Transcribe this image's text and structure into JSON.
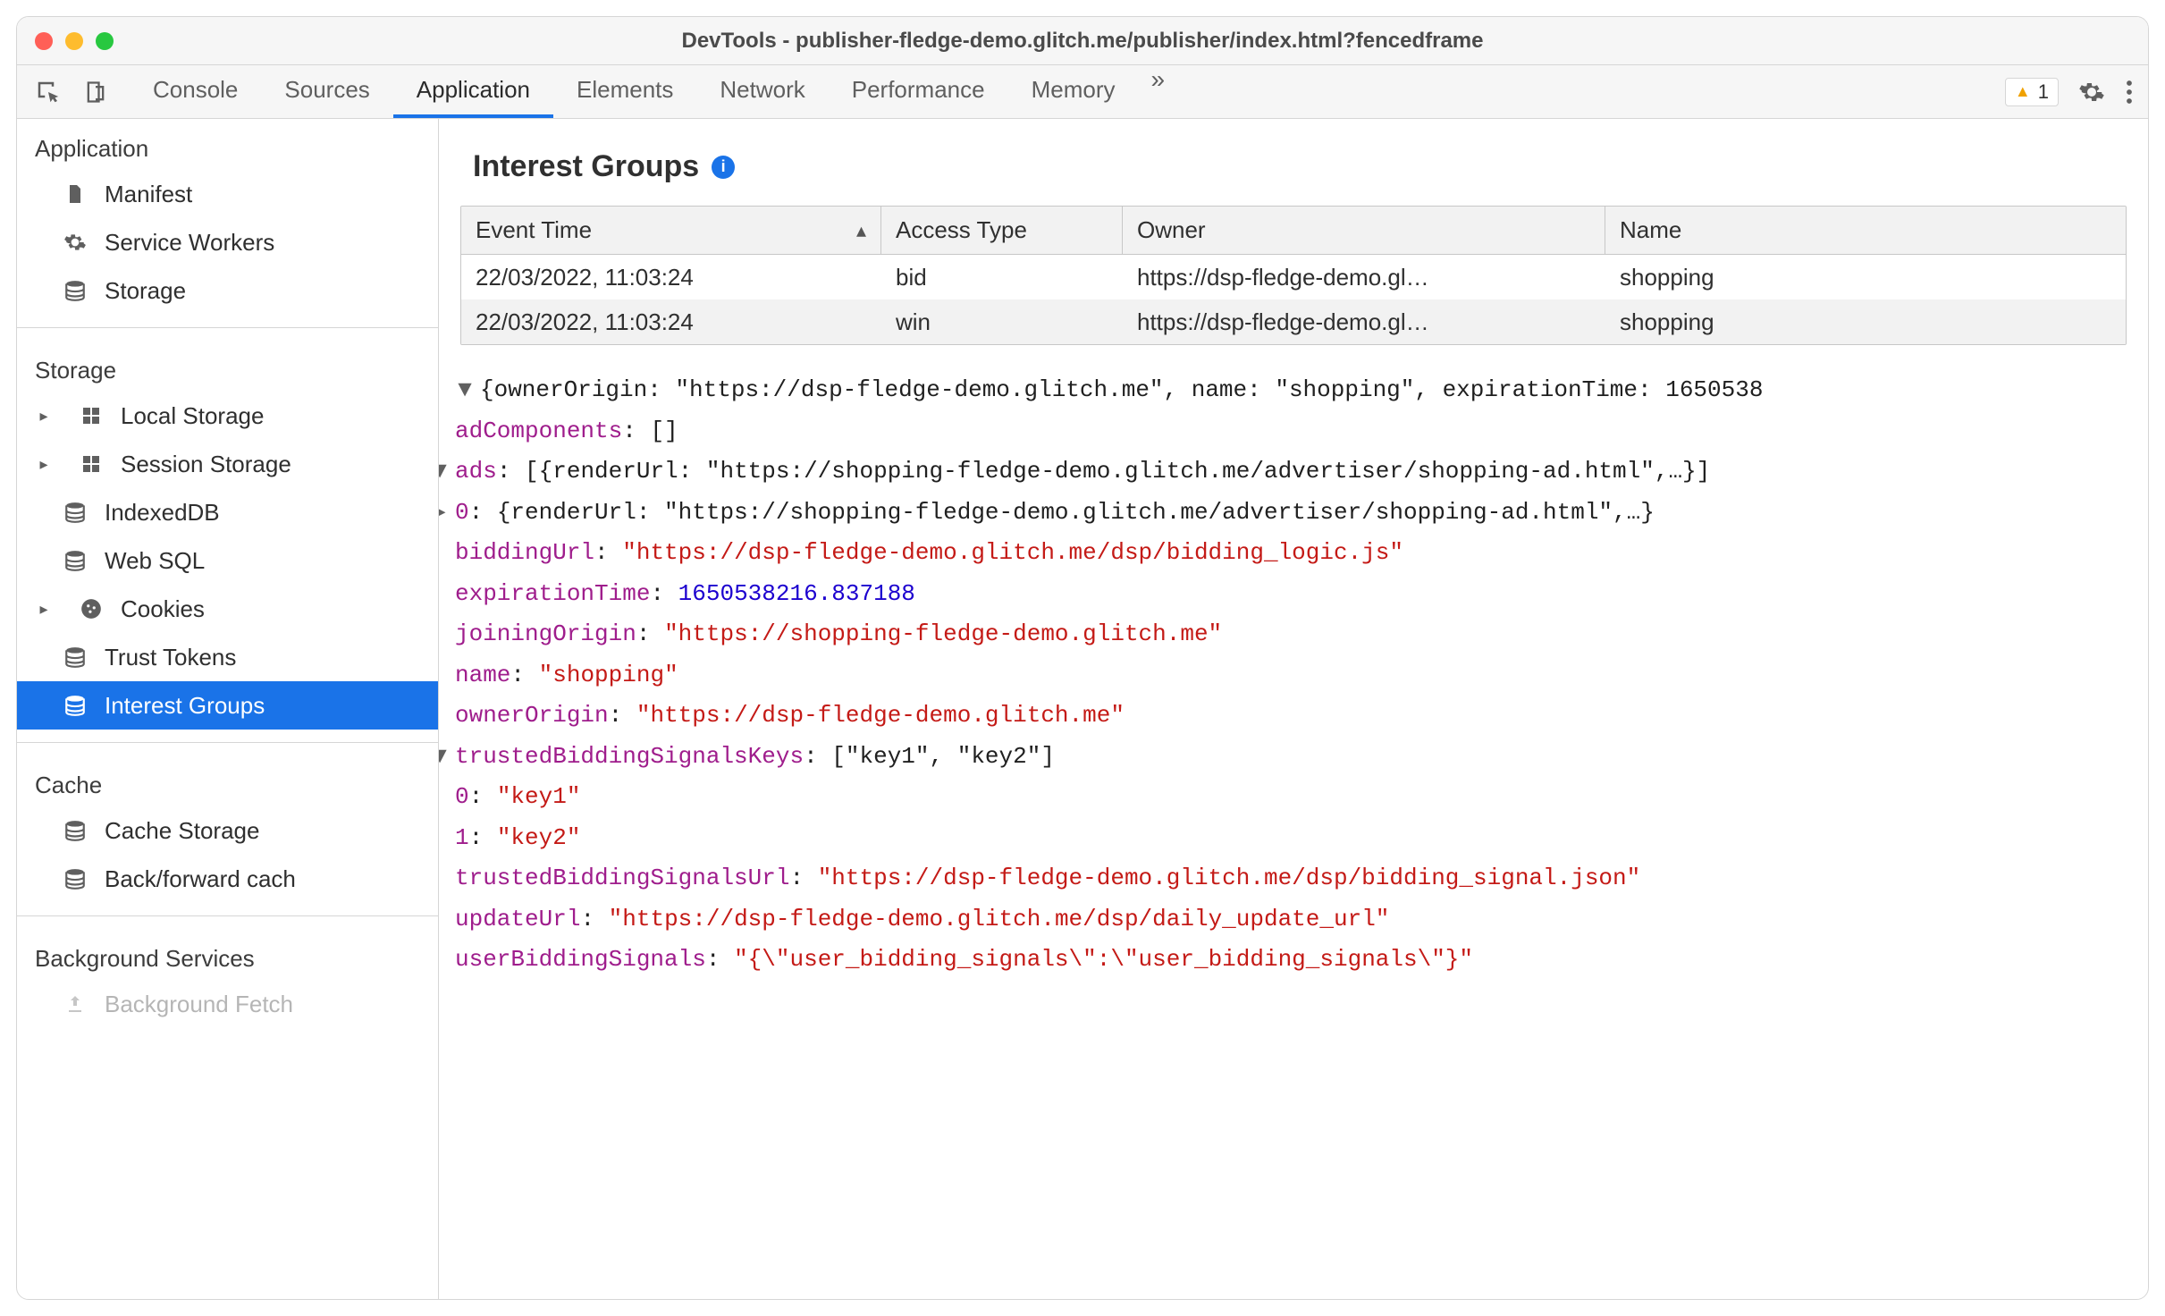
{
  "window": {
    "title": "DevTools - publisher-fledge-demo.glitch.me/publisher/index.html?fencedframe"
  },
  "tabs": {
    "console": "Console",
    "sources": "Sources",
    "application": "Application",
    "elements": "Elements",
    "network": "Network",
    "performance": "Performance",
    "memory": "Memory"
  },
  "warn_count": "1",
  "sidebar": {
    "application": {
      "header": "Application",
      "manifest": "Manifest",
      "service_workers": "Service Workers",
      "storage": "Storage"
    },
    "storage": {
      "header": "Storage",
      "local": "Local Storage",
      "session": "Session Storage",
      "indexeddb": "IndexedDB",
      "websql": "Web SQL",
      "cookies": "Cookies",
      "trust_tokens": "Trust Tokens",
      "interest_groups": "Interest Groups"
    },
    "cache": {
      "header": "Cache",
      "cache_storage": "Cache Storage",
      "bfcache": "Back/forward cach"
    },
    "bg": {
      "header": "Background Services",
      "bg_fetch": "Background Fetch"
    }
  },
  "main": {
    "heading": "Interest Groups",
    "columns": {
      "event_time": "Event Time",
      "access_type": "Access Type",
      "owner": "Owner",
      "name": "Name"
    },
    "rows": [
      {
        "time": "22/03/2022, 11:03:24",
        "access": "bid",
        "owner": "https://dsp-fledge-demo.gl…",
        "name": "shopping"
      },
      {
        "time": "22/03/2022, 11:03:24",
        "access": "win",
        "owner": "https://dsp-fledge-demo.gl…",
        "name": "shopping"
      }
    ]
  },
  "obj": {
    "line_top": "{ownerOrigin: \"https://dsp-fledge-demo.glitch.me\", name: \"shopping\", expirationTime: 1650538",
    "adComponents_k": "adComponents",
    "adComponents_v": "[]",
    "ads_k": "ads",
    "ads_v": "[{renderUrl: \"https://shopping-fledge-demo.glitch.me/advertiser/shopping-ad.html\",…}]",
    "ads0_k": "0",
    "ads0_v": "{renderUrl: \"https://shopping-fledge-demo.glitch.me/advertiser/shopping-ad.html\",…}",
    "biddingUrl_k": "biddingUrl",
    "biddingUrl_v": "\"https://dsp-fledge-demo.glitch.me/dsp/bidding_logic.js\"",
    "expirationTime_k": "expirationTime",
    "expirationTime_v": "1650538216.837188",
    "joiningOrigin_k": "joiningOrigin",
    "joiningOrigin_v": "\"https://shopping-fledge-demo.glitch.me\"",
    "name_k": "name",
    "name_v": "\"shopping\"",
    "ownerOrigin_k": "ownerOrigin",
    "ownerOrigin_v": "\"https://dsp-fledge-demo.glitch.me\"",
    "tbsk_k": "trustedBiddingSignalsKeys",
    "tbsk_v": "[\"key1\", \"key2\"]",
    "tbsk0_k": "0",
    "tbsk0_v": "\"key1\"",
    "tbsk1_k": "1",
    "tbsk1_v": "\"key2\"",
    "tbsu_k": "trustedBiddingSignalsUrl",
    "tbsu_v": "\"https://dsp-fledge-demo.glitch.me/dsp/bidding_signal.json\"",
    "updateUrl_k": "updateUrl",
    "updateUrl_v": "\"https://dsp-fledge-demo.glitch.me/dsp/daily_update_url\"",
    "ubs_k": "userBiddingSignals",
    "ubs_v": "\"{\\\"user_bidding_signals\\\":\\\"user_bidding_signals\\\"}\""
  }
}
